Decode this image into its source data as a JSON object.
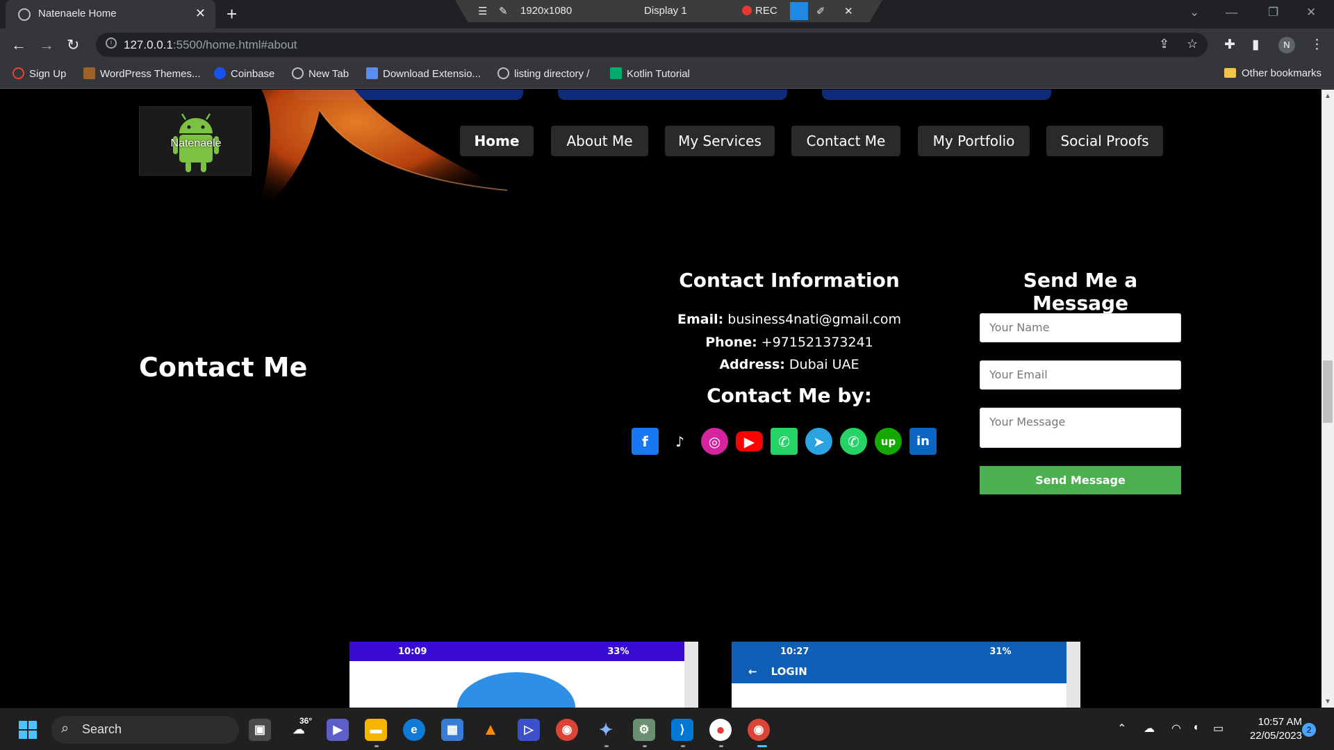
{
  "browser": {
    "tab_title": "Natenaele Home",
    "url_host": "127.0.0.1",
    "url_path": ":5500/home.html#about",
    "bookmarks": [
      "Sign Up",
      "WordPress Themes...",
      "Coinbase",
      "New Tab",
      "Download Extensio...",
      "listing directory /",
      "Kotlin Tutorial"
    ],
    "other_bookmarks": "Other bookmarks",
    "profile_initial": "N"
  },
  "recorder": {
    "resolution": "1920x1080",
    "display": "Display 1",
    "rec_label": "REC"
  },
  "site": {
    "logo_text": "Natenaele",
    "nav": [
      "Home",
      "About Me",
      "My Services",
      "Contact Me",
      "My Portfolio",
      "Social Proofs"
    ],
    "section_title": "Contact Me",
    "contact_info_heading": "Contact Information",
    "email_label": "Email:",
    "email_value": "business4nati@gmail.com",
    "phone_label": "Phone:",
    "phone_value": "+971521373241",
    "address_label": "Address:",
    "address_value": "Dubai UAE",
    "contact_by_heading": "Contact Me by:",
    "social_icons": [
      "facebook-icon",
      "tiktok-icon",
      "instagram-icon",
      "youtube-icon",
      "whatsapp-icon",
      "telegram-icon",
      "phone-call-icon",
      "upwork-icon",
      "linkedin-icon"
    ],
    "message_heading": "Send Me a Message",
    "name_placeholder": "Your Name",
    "email_placeholder": "Your Email",
    "message_placeholder": "Your Message",
    "send_button": "Send Message",
    "portfolio_shot_1": {
      "time": "10:09",
      "battery": "33%"
    },
    "portfolio_shot_2": {
      "time": "10:27",
      "battery": "31%",
      "screen_title": "LOGIN"
    }
  },
  "taskbar": {
    "search_label": "Search",
    "weather_temp": "36°",
    "time": "10:57 AM",
    "date": "22/05/2023",
    "notifications": "2"
  },
  "colors": {
    "send_button": "#4caf50",
    "page_background": "#000000",
    "nav_button": "#2a2a2a"
  }
}
